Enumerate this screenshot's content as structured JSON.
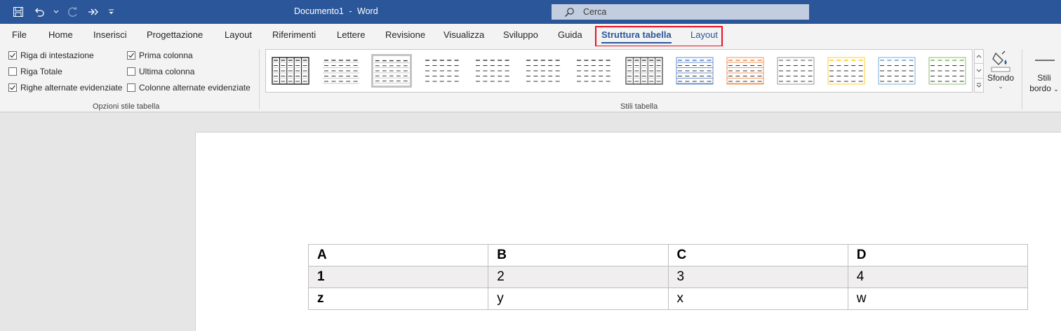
{
  "titlebar": {
    "doc_name": "Documento1",
    "separator": "-",
    "app_name": "Word",
    "search_placeholder": "Cerca"
  },
  "tabs": [
    {
      "label": "File"
    },
    {
      "label": "Home"
    },
    {
      "label": "Inserisci"
    },
    {
      "label": "Progettazione"
    },
    {
      "label": "Layout"
    },
    {
      "label": "Riferimenti"
    },
    {
      "label": "Lettere"
    },
    {
      "label": "Revisione"
    },
    {
      "label": "Visualizza"
    },
    {
      "label": "Sviluppo"
    },
    {
      "label": "Guida"
    },
    {
      "label": "Struttura tabella",
      "active": true
    },
    {
      "label": "Layout",
      "contextual": true
    }
  ],
  "table_style_options": {
    "group_label": "Opzioni stile tabella",
    "options": [
      {
        "label": "Riga di intestazione",
        "checked": true
      },
      {
        "label": "Riga Totale",
        "checked": false
      },
      {
        "label": "Righe alternate evidenziate",
        "checked": true
      },
      {
        "label": "Prima colonna",
        "checked": true
      },
      {
        "label": "Ultima colonna",
        "checked": false
      },
      {
        "label": "Colonne alternate evidenziate",
        "checked": false
      }
    ]
  },
  "table_styles": {
    "group_label": "Stili tabella",
    "shading_label": "Sfondo",
    "border_styles_label_1": "Stili",
    "border_styles_label_2": "bordo",
    "thumb_colors": [
      "#000000",
      "#555555",
      "#555555",
      "#555555",
      "#555555",
      "#555555",
      "#555555",
      "#333333",
      "#4472c4",
      "#ed7d31",
      "#7f7f7f",
      "#ffc000",
      "#5b9bd5",
      "#70ad47"
    ]
  },
  "document": {
    "table": [
      [
        "A",
        "B",
        "C",
        "D"
      ],
      [
        "1",
        "2",
        "3",
        "4"
      ],
      [
        "z",
        "y",
        "x",
        "w"
      ]
    ]
  },
  "colors": {
    "title_bar": "#2b579a",
    "highlight_border": "#e81123"
  }
}
